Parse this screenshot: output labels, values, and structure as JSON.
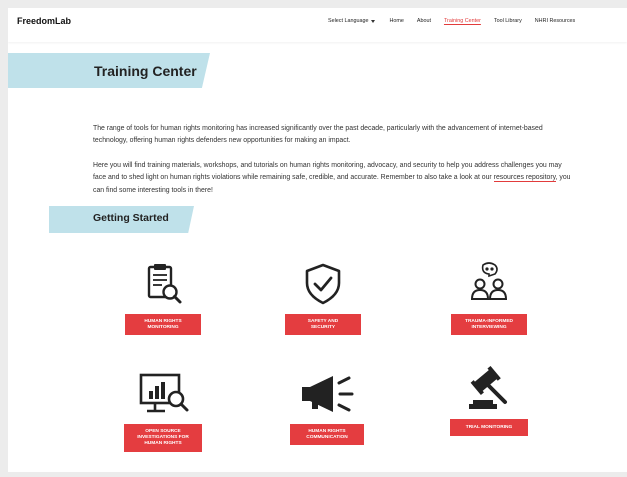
{
  "header": {
    "logo": "FreedomLab",
    "language_label": "Select Language",
    "nav": [
      {
        "label": "Home",
        "active": false
      },
      {
        "label": "About",
        "active": false
      },
      {
        "label": "Training Center",
        "active": true
      },
      {
        "label": "Tool Library",
        "active": false
      },
      {
        "label": "NHRI Resources",
        "active": false
      }
    ]
  },
  "main": {
    "title": "Training Center",
    "intro": "The range of tools for human rights monitoring has increased significantly over the past decade, particularly with the advancement of internet-based technology, offering human rights defenders new opportunities for making an impact.",
    "body_before_link": "Here you will find training materials, workshops, and tutorials on human rights monitoring, advocacy, and security to help you address challenges you may face and to shed light on human rights violations while remaining safe, credible, and accurate. Remember to also take a look at our ",
    "link_text": "resources repository",
    "body_after_link": ", you can find some interesting tools in there!",
    "section_title": "Getting Started"
  },
  "cards": [
    {
      "label": "HUMAN RIGHTS\nMONITORING",
      "icon": "clipboard-magnifier-icon"
    },
    {
      "label": "SAFETY AND\nSECURITY",
      "icon": "shield-check-icon"
    },
    {
      "label": "TRAUMA-INFORMED\nINTERVIEWING",
      "icon": "people-speech-icon"
    },
    {
      "label": "OPEN SOURCE\nINVESTIGATIONS FOR\nHUMAN RIGHTS",
      "icon": "monitor-chart-magnifier-icon"
    },
    {
      "label": "HUMAN RIGHTS\nCOMMUNICATION",
      "icon": "megaphone-icon"
    },
    {
      "label": "TRIAL MONITORING",
      "icon": "gavel-icon"
    }
  ],
  "colors": {
    "accent_red": "#e43d40",
    "banner_blue": "#bfe1ea",
    "active_nav": "#e23b3b"
  }
}
